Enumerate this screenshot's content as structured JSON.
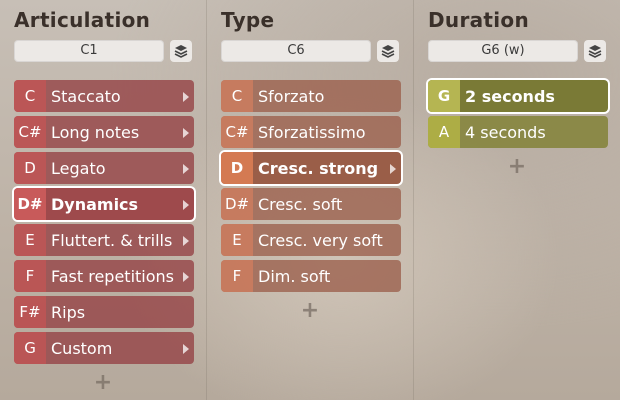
{
  "columns": [
    {
      "title": "Articulation",
      "selector": "C1",
      "items": [
        {
          "key": "C",
          "label": "Staccato",
          "arrow": true
        },
        {
          "key": "C#",
          "label": "Long notes",
          "arrow": true
        },
        {
          "key": "D",
          "label": "Legato",
          "arrow": true
        },
        {
          "key": "D#",
          "label": "Dynamics",
          "arrow": true,
          "selected": true
        },
        {
          "key": "E",
          "label": "Fluttert. & trills",
          "arrow": true
        },
        {
          "key": "F",
          "label": "Fast repetitions",
          "arrow": true
        },
        {
          "key": "F#",
          "label": "Rips",
          "arrow": false
        },
        {
          "key": "G",
          "label": "Custom",
          "arrow": true
        }
      ]
    },
    {
      "title": "Type",
      "selector": "C6",
      "items": [
        {
          "key": "C",
          "label": "Sforzato",
          "arrow": false
        },
        {
          "key": "C#",
          "label": "Sforzatissimo",
          "arrow": false
        },
        {
          "key": "D",
          "label": "Cresc. strong",
          "arrow": true,
          "selected": true
        },
        {
          "key": "D#",
          "label": "Cresc. soft",
          "arrow": false
        },
        {
          "key": "E",
          "label": "Cresc. very soft",
          "arrow": false
        },
        {
          "key": "F",
          "label": "Dim. soft",
          "arrow": false
        }
      ]
    },
    {
      "title": "Duration",
      "selector": "G6 (w)",
      "items": [
        {
          "key": "G",
          "label": "2 seconds",
          "arrow": false,
          "selected": true
        },
        {
          "key": "A",
          "label": "4 seconds",
          "arrow": false
        }
      ]
    }
  ],
  "icons": {
    "layers": "layers-icon",
    "add": "plus-icon",
    "submenu": "chevron-right-icon"
  },
  "colors": {
    "articulation": "#9e4a4c",
    "type": "#d47a52",
    "duration": "#b5b552"
  }
}
